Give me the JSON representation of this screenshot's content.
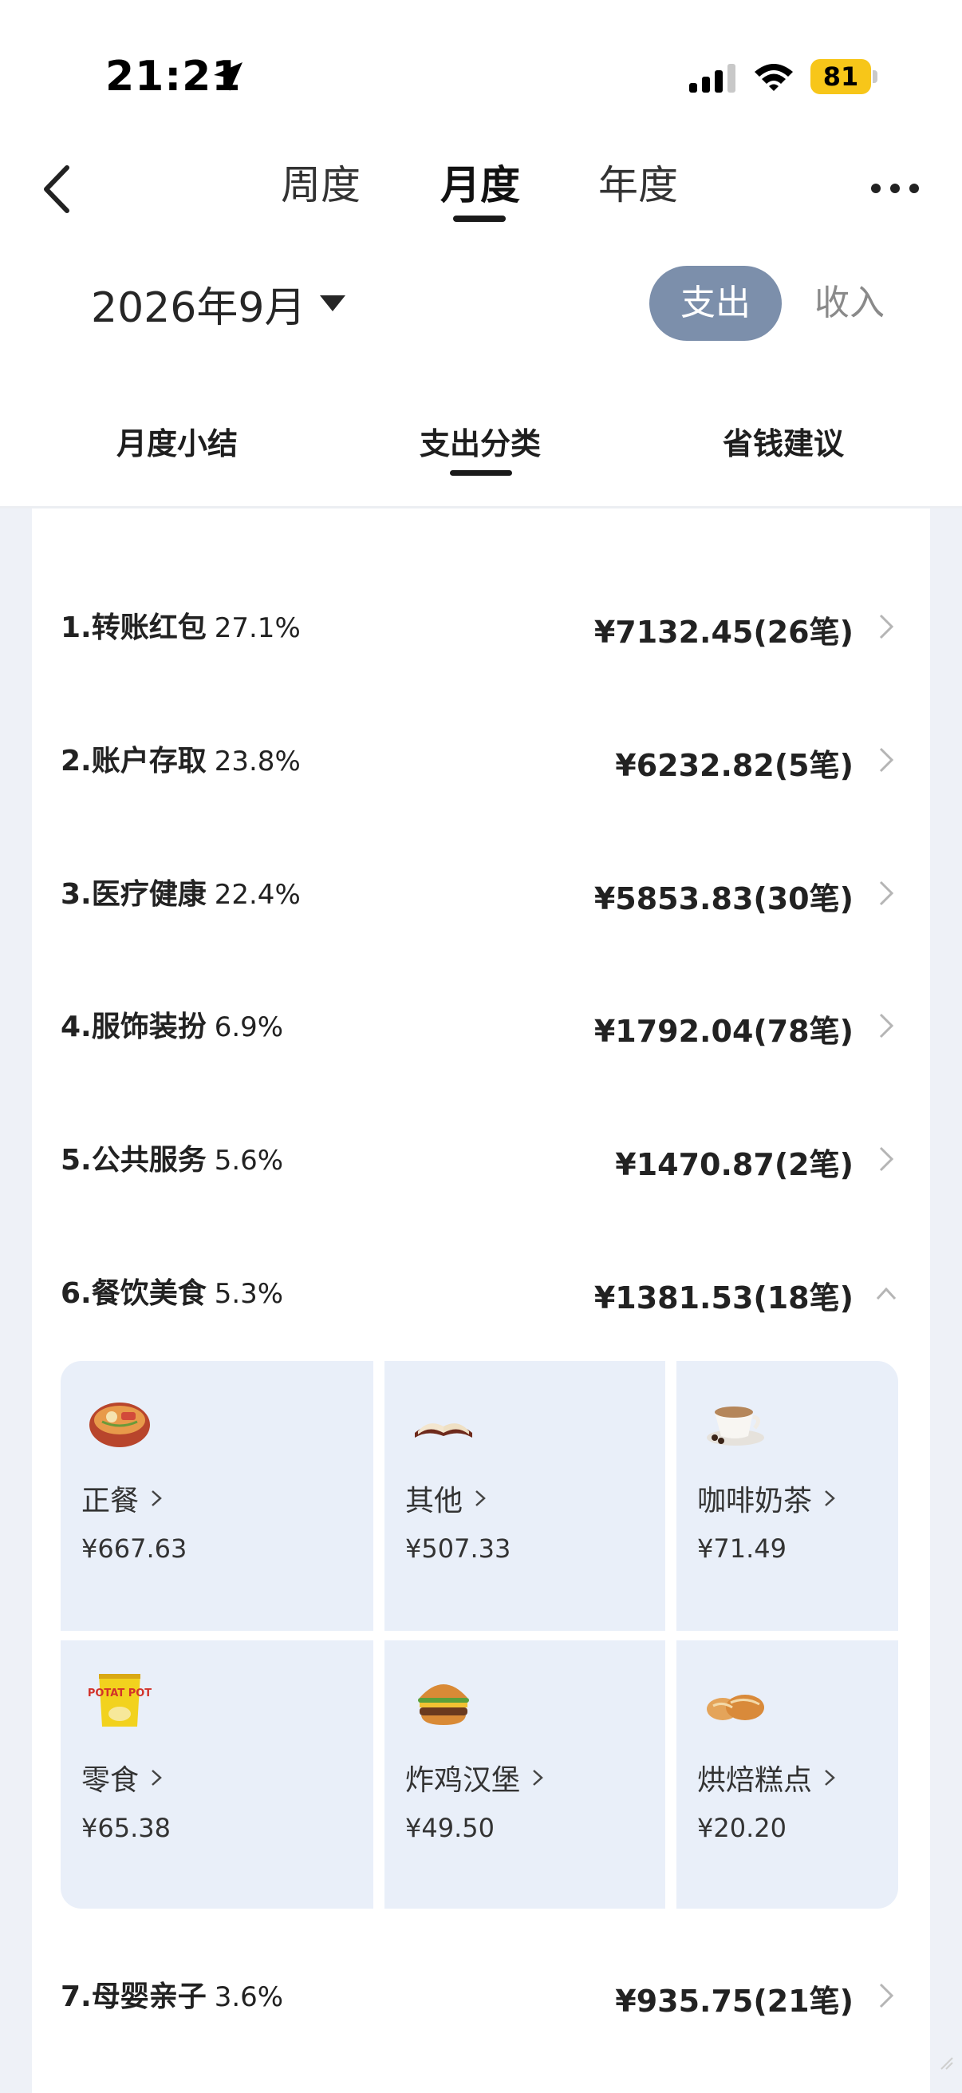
{
  "status_bar": {
    "time": "21:21",
    "battery": "81"
  },
  "nav": {
    "tabs": [
      {
        "label": "周度"
      },
      {
        "label": "月度",
        "active": true
      },
      {
        "label": "年度"
      }
    ]
  },
  "month_selector": {
    "label": "2026年9月"
  },
  "type_toggle": {
    "expense": "支出",
    "income": "收入",
    "active": "expense"
  },
  "sub_tabs": [
    {
      "label": "月度小结"
    },
    {
      "label": "支出分类",
      "active": true
    },
    {
      "label": "省钱建议"
    }
  ],
  "categories": [
    {
      "name": "1.转账红包",
      "percent": "27.1%",
      "amount": "¥7132.45(26笔)"
    },
    {
      "name": "2.账户存取",
      "percent": "23.8%",
      "amount": "¥6232.82(5笔)"
    },
    {
      "name": "3.医疗健康",
      "percent": "22.4%",
      "amount": "¥5853.83(30笔)"
    },
    {
      "name": "4.服饰装扮",
      "percent": "6.9%",
      "amount": "¥1792.04(78笔)"
    },
    {
      "name": "5.公共服务",
      "percent": "5.6%",
      "amount": "¥1470.87(2笔)"
    },
    {
      "name": "6.餐饮美食",
      "percent": "5.3%",
      "amount": "¥1381.53(18笔)",
      "expanded": true
    },
    {
      "name": "7.母婴亲子",
      "percent": "3.6%",
      "amount": "¥935.75(21笔)"
    }
  ],
  "subcategories": [
    {
      "name": "正餐",
      "amount": "¥667.63",
      "icon": "noodle-bowl-icon"
    },
    {
      "name": "其他",
      "amount": "¥507.33",
      "icon": "open-book-icon"
    },
    {
      "name": "咖啡奶茶",
      "amount": "¥71.49",
      "icon": "coffee-cup-icon"
    },
    {
      "name": "零食",
      "amount": "¥65.38",
      "icon": "chips-bag-icon",
      "icon_text": "POTAT POT"
    },
    {
      "name": "炸鸡汉堡",
      "amount": "¥49.50",
      "icon": "burger-icon"
    },
    {
      "name": "烘焙糕点",
      "amount": "¥20.20",
      "icon": "bread-icon"
    }
  ],
  "colors": {
    "accent": "#7c8fab",
    "subcategory_bg": "#e9eff9",
    "page_bg": "#eef1f7",
    "battery": "#f7c619"
  }
}
